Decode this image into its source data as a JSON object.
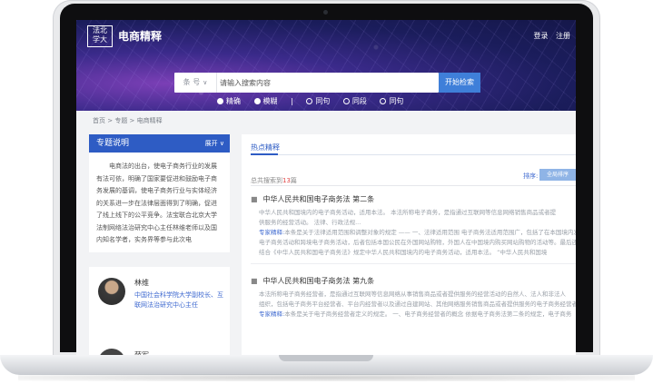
{
  "header": {
    "logo_text": [
      "法北",
      "学大"
    ],
    "site_title": "电商精释",
    "login": "登录",
    "register": "注册"
  },
  "search": {
    "type_label": "条 号",
    "placeholder": "请输入搜索内容",
    "button": "开始检索",
    "options": [
      {
        "label": "精确",
        "selected": true
      },
      {
        "label": "模糊",
        "selected": true
      },
      {
        "label": "同句",
        "selected": false
      },
      {
        "label": "同段",
        "selected": false
      },
      {
        "label": "同句",
        "selected": false
      }
    ]
  },
  "breadcrumb": "首页 > 专题 > 电商精释",
  "sidebar": {
    "title": "专题说明",
    "expand": "展开",
    "text": "电商法的出台，使电子商务行业的发展有法可依，明确了国家要促进和鼓励电子商务发展的基调，使电子商务行业与实体经济的关系进一步在法律层面得到了明确，促进了线上线下的公平竞争。法宝联合北京大学法制网络法治研究中心主任林维老师以及国内知名学者，实务界等参与此次电"
  },
  "person": {
    "name": "林维",
    "desc": "中国社会科学院大学副校长、互联网法治研究中心主任",
    "next_name": "薛军"
  },
  "main": {
    "tab": "热点精释",
    "count_prefix": "总共搜索到",
    "count": "13",
    "count_suffix": "篇",
    "sort_label": "排序:",
    "sort_button": "全局排序",
    "articles": [
      {
        "title": "中华人民共和国电子商务法 第二条",
        "body1": "中华人民共和国境内的电子商务活动，适用本法。      本法所称电子商务，是指通过互联网等信息网络销售商品或者提",
        "body2": "供服务的经营活动。       法律、行政法规...",
        "hl_label": "专家精释:",
        "hl1": "本条是关于法律适用范围和调整对象的规定 —— 一、法律适用范围 电子商务法适用范围广，包括了在本国境内发生",
        "hl2": "电子商务活动和跨境电子商务活动，后者包括本国公民在外国网站购物，外国人在中国境内购买网站购物的活动等。最后还",
        "hl3": "结合《中华人民共和国电子商务法》规定中华人民共和国境内的电子商务活动，适用本法。 “中华人民共和国境"
      },
      {
        "title": "中华人民共和国电子商务法 第九条",
        "body1": "本法所称电子商务经营者，是指通过互联网等信息网络从事销售商品或者提供服务的经营活动的自然人、法人和非法人",
        "body2": "组织，包括电子商务平台经营者、平台内经营者以及通过自建网站、其他网络服务销售商品或者提供服务的电子商务经营者",
        "hl_label": "专家精释:",
        "hl1": "本条是关于电子商务经营者定义的规定。 一、电子商务经营者的概念 依据电子商务法第二条的规定，电子商务",
        "hl2": "",
        "hl3": ""
      }
    ]
  }
}
